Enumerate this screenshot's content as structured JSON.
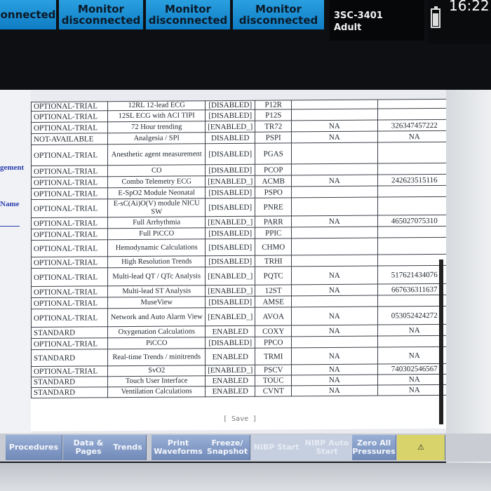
{
  "top": {
    "tiles": [
      {
        "line1": "",
        "line2": "onnected"
      },
      {
        "line1": "Monitor",
        "line2": "disconnected"
      },
      {
        "line1": "Monitor",
        "line2": "disconnected"
      },
      {
        "line1": "Monitor",
        "line2": "disconnected"
      }
    ],
    "patient": {
      "bed": "3SC-3401",
      "type": "Adult"
    },
    "clock": "16:22",
    "battery_icon": "battery-icon",
    "battery_level_pct": 80
  },
  "side": {
    "label1": "gement",
    "label2": "Name"
  },
  "table": {
    "rows": [
      {
        "status": "OPTIONAL-TRIAL",
        "feature": "12RL 12-lead ECG",
        "state": "[DISABLED]",
        "code": "P12R",
        "num": "",
        "serial": ""
      },
      {
        "status": "OPTIONAL-TRIAL",
        "feature": "12SL ECG with ACI TIPI",
        "state": "[DISABLED]",
        "code": "P12S",
        "num": "",
        "serial": ""
      },
      {
        "status": "OPTIONAL-TRIAL",
        "feature": "72 Hour trending",
        "state": "[ENABLED_]",
        "code": "TR72",
        "num": "NA",
        "serial": "326347457222"
      },
      {
        "status": "NOT-AVAILABLE",
        "feature": "Analgesia / SPI",
        "state": "DISABLED",
        "code": "PSPI",
        "num": "NA",
        "serial": "NA"
      },
      {
        "status": "OPTIONAL-TRIAL",
        "feature": "Anesthetic agent measurement",
        "state": "[DISABLED]",
        "code": "PGAS",
        "num": "",
        "serial": ""
      },
      {
        "status": "OPTIONAL-TRIAL",
        "feature": "CO",
        "state": "[DISABLED]",
        "code": "PCOP",
        "num": "",
        "serial": ""
      },
      {
        "status": "OPTIONAL-TRIAL",
        "feature": "Combo Telemetry ECG",
        "state": "[ENABLED_]",
        "code": "ACMB",
        "num": "NA",
        "serial": "242623515116"
      },
      {
        "status": "OPTIONAL-TRIAL",
        "feature": "E-SpO2 Module Neonatal",
        "state": "[DISABLED]",
        "code": "PSPO",
        "num": "",
        "serial": ""
      },
      {
        "status": "OPTIONAL-TRIAL",
        "feature": "E-sC(Ai)O(V) module NICU SW",
        "state": "[DISABLED]",
        "code": "PNRE",
        "num": "",
        "serial": ""
      },
      {
        "status": "OPTIONAL-TRIAL",
        "feature": "Full Arrhythmia",
        "state": "[ENABLED_]",
        "code": "PARR",
        "num": "NA",
        "serial": "465027075310"
      },
      {
        "status": "OPTIONAL-TRIAL",
        "feature": "Full PiCCO",
        "state": "[DISABLED]",
        "code": "PPIC",
        "num": "",
        "serial": ""
      },
      {
        "status": "OPTIONAL-TRIAL",
        "feature": "Hemodynamic Calculations",
        "state": "[DISABLED]",
        "code": "CHMO",
        "num": "",
        "serial": ""
      },
      {
        "status": "OPTIONAL-TRIAL",
        "feature": "High Resolution Trends",
        "state": "[DISABLED]",
        "code": "TRHI",
        "num": "",
        "serial": ""
      },
      {
        "status": "OPTIONAL-TRIAL",
        "feature": "Multi-lead QT / QTc Analysis",
        "state": "[ENABLED_]",
        "code": "PQTC",
        "num": "NA",
        "serial": "517621434076"
      },
      {
        "status": "OPTIONAL-TRIAL",
        "feature": "Multi-lead ST Analysis",
        "state": "[ENABLED_]",
        "code": "12ST",
        "num": "NA",
        "serial": "667636311637"
      },
      {
        "status": "OPTIONAL-TRIAL",
        "feature": "MuseView",
        "state": "[DISABLED]",
        "code": "AMSE",
        "num": "",
        "serial": ""
      },
      {
        "status": "OPTIONAL-TRIAL",
        "feature": "Network and Auto Alarm View",
        "state": "[ENABLED_]",
        "code": "AVOA",
        "num": "NA",
        "serial": "053052424272"
      },
      {
        "status": "STANDARD",
        "feature": "Oxygenation Calculations",
        "state": "ENABLED",
        "code": "COXY",
        "num": "NA",
        "serial": "NA"
      },
      {
        "status": "OPTIONAL-TRIAL",
        "feature": "PiCCO",
        "state": "[DISABLED]",
        "code": "PPCO",
        "num": "",
        "serial": ""
      },
      {
        "status": "STANDARD",
        "feature": "Real-time Trends / minitrends",
        "state": "ENABLED",
        "code": "TRMI",
        "num": "NA",
        "serial": "NA"
      },
      {
        "status": "OPTIONAL-TRIAL",
        "feature": "SvO2",
        "state": "[ENABLED_]",
        "code": "PSCV",
        "num": "NA",
        "serial": "740302546567"
      },
      {
        "status": "STANDARD",
        "feature": "Touch User Interface",
        "state": "ENABLED",
        "code": "TOUC",
        "num": "NA",
        "serial": "NA"
      },
      {
        "status": "STANDARD",
        "feature": "Ventilation Calculations",
        "state": "ENABLED",
        "code": "CVNT",
        "num": "NA",
        "serial": "NA"
      }
    ]
  },
  "save_label": "[ Save ]",
  "toolbar": [
    {
      "name": "procedures-button",
      "label": "Procedures",
      "disabled": false
    },
    {
      "name": "data-pages-button",
      "label": "Data & Pages",
      "disabled": false
    },
    {
      "name": "trends-button",
      "label": "Trends",
      "disabled": false
    },
    {
      "name": "print-waveforms-button",
      "label": "Print Waveforms",
      "disabled": false
    },
    {
      "name": "freeze-snapshot-button",
      "label": "Freeze/ Snapshot",
      "disabled": false
    },
    {
      "name": "nibp-start-button",
      "label": "NIBP Start",
      "disabled": true
    },
    {
      "name": "nibp-auto-start-button",
      "label": "NIBP Auto Start",
      "disabled": true
    },
    {
      "name": "zero-all-pressures-button",
      "label": "Zero All Pressures",
      "disabled": false
    },
    {
      "name": "alarm-silence-button",
      "label": "⚠",
      "disabled": false
    }
  ]
}
